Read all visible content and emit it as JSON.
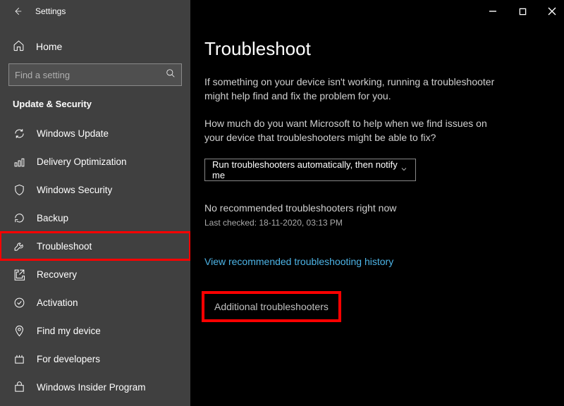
{
  "titlebar": {
    "title": "Settings"
  },
  "home_label": "Home",
  "search": {
    "placeholder": "Find a setting"
  },
  "category": "Update & Security",
  "nav": [
    {
      "label": "Windows Update"
    },
    {
      "label": "Delivery Optimization"
    },
    {
      "label": "Windows Security"
    },
    {
      "label": "Backup"
    },
    {
      "label": "Troubleshoot"
    },
    {
      "label": "Recovery"
    },
    {
      "label": "Activation"
    },
    {
      "label": "Find my device"
    },
    {
      "label": "For developers"
    },
    {
      "label": "Windows Insider Program"
    }
  ],
  "main": {
    "heading": "Troubleshoot",
    "para1": "If something on your device isn't working, running a troubleshooter might help find and fix the problem for you.",
    "para2": "How much do you want Microsoft to help when we find issues on your device that troubleshooters might be able to fix?",
    "dropdown_value": "Run troubleshooters automatically, then notify me",
    "no_rec": "No recommended troubleshooters right now",
    "last_checked": "Last checked: 18-11-2020, 03:13 PM",
    "link": "View recommended troubleshooting history",
    "additional": "Additional troubleshooters"
  }
}
